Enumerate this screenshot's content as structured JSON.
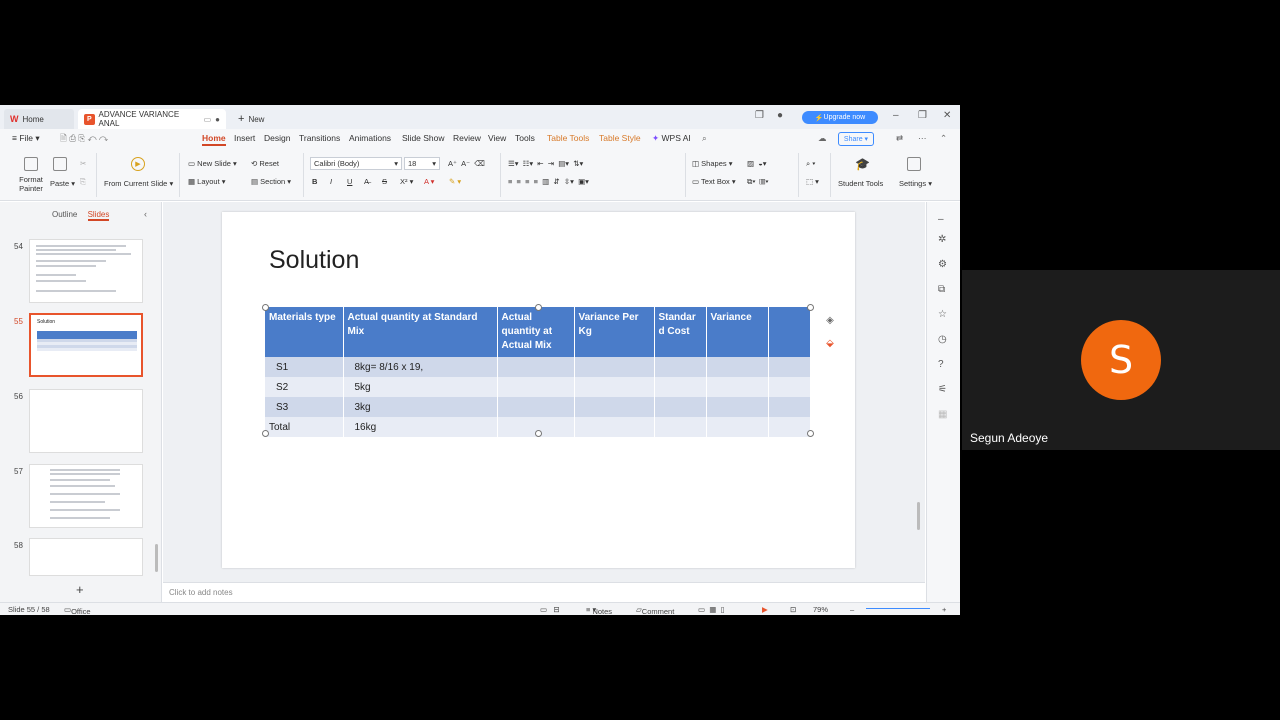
{
  "tabs": {
    "home": "Home",
    "document": "ADVANCE VARIANCE ANAL",
    "new": "New",
    "upgrade": "Upgrade now"
  },
  "menu": {
    "file": "File",
    "items": [
      "Home",
      "Insert",
      "Design",
      "Transitions",
      "Animations",
      "Slide Show",
      "Review",
      "View",
      "Tools"
    ],
    "context": [
      "Table Tools",
      "Table Style"
    ],
    "wps_ai": "WPS AI",
    "share": "Share"
  },
  "ribbon": {
    "format_painter": "Format Painter",
    "paste": "Paste",
    "from_current_slide": "From Current Slide",
    "new_slide": "New Slide",
    "reset": "Reset",
    "layout": "Layout",
    "section": "Section",
    "font_name": "Calibri (Body)",
    "font_size": "18",
    "shapes": "Shapes",
    "text_box": "Text Box",
    "student_tools": "Student Tools",
    "settings": "Settings"
  },
  "left_panel": {
    "outline_tab": "Outline",
    "slides_tab": "Slides",
    "thumbnails": [
      {
        "number": "54"
      },
      {
        "number": "55",
        "title": "Solution"
      },
      {
        "number": "56"
      },
      {
        "number": "57"
      },
      {
        "number": "58"
      }
    ]
  },
  "slide": {
    "title": "Solution",
    "table": {
      "headers": [
        "Materials type",
        "Actual quantity at Standard Mix",
        "Actual quantity at Actual Mix",
        "Variance Per Kg",
        "Standar d Cost",
        "Variance",
        ""
      ],
      "rows": [
        [
          "S1",
          "8kg=  8/16 x 19,",
          "",
          "",
          "",
          "",
          ""
        ],
        [
          "S2",
          "5kg",
          "",
          "",
          "",
          "",
          ""
        ],
        [
          "S3",
          "3kg",
          "",
          "",
          "",
          "",
          ""
        ],
        [
          "Total",
          "16kg",
          "",
          "",
          "",
          "",
          ""
        ]
      ]
    }
  },
  "notes_placeholder": "Click to add notes",
  "status": {
    "slide_counter": "Slide 55 / 58",
    "theme": "Office Theme",
    "notes": "Notes",
    "comment": "Comment",
    "zoom": "79%"
  },
  "participant": {
    "initial": "S",
    "name": "Segun Adeoye",
    "avatar_color": "#f0680f"
  }
}
